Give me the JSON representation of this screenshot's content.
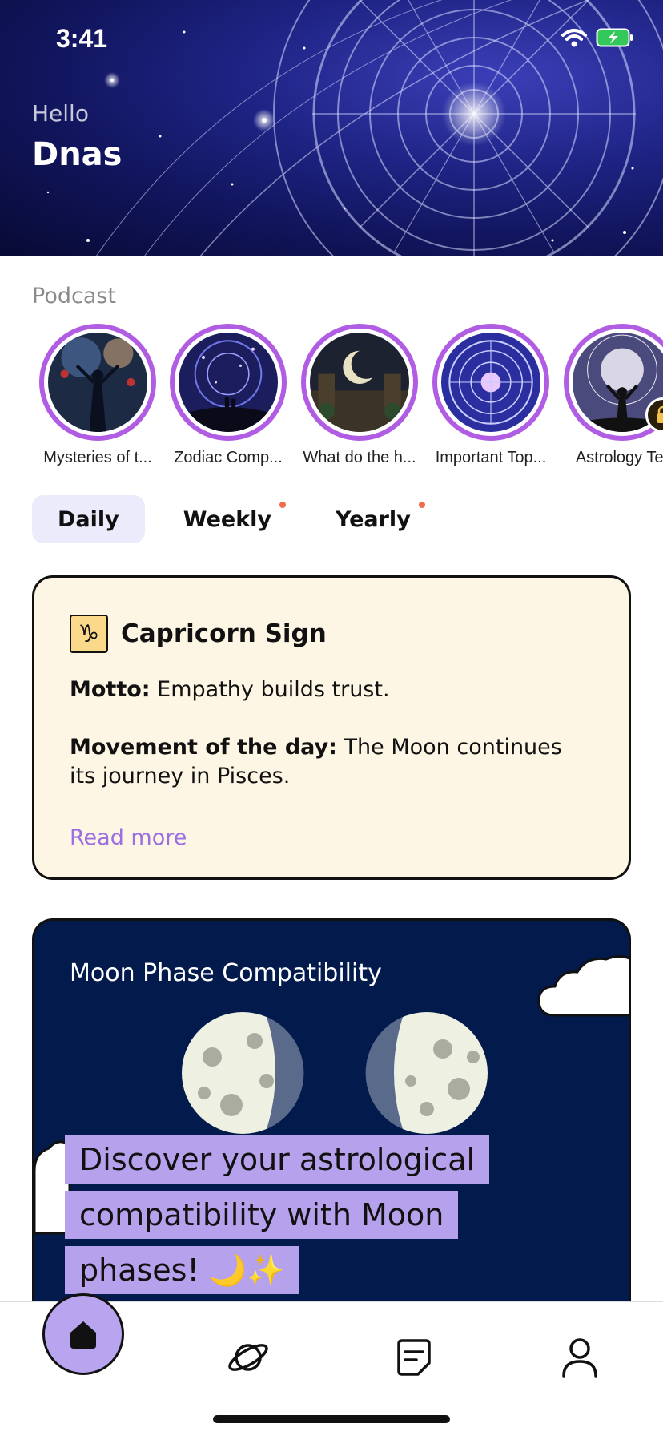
{
  "status_bar": {
    "time": "3:41"
  },
  "greeting": {
    "hello": "Hello",
    "name": "Dnas"
  },
  "podcast": {
    "title": "Podcast",
    "items": [
      {
        "label": "Mysteries of t...",
        "locked": false
      },
      {
        "label": "Zodiac Comp...",
        "locked": false
      },
      {
        "label": "What do the h...",
        "locked": false
      },
      {
        "label": "Important Top...",
        "locked": false
      },
      {
        "label": "Astrology Ter",
        "locked": true
      }
    ]
  },
  "tabs": [
    {
      "label": "Daily",
      "active": true,
      "dot": false
    },
    {
      "label": "Weekly",
      "active": false,
      "dot": true
    },
    {
      "label": "Yearly",
      "active": false,
      "dot": true
    }
  ],
  "sign_card": {
    "icon": "capricorn-icon",
    "title": "Capricorn Sign",
    "motto_label": "Motto:",
    "motto_text": " Empathy builds trust.",
    "movement_label": "Movement of the day:",
    "movement_text": " The Moon continues its journey in Pisces.",
    "read_more": "Read more"
  },
  "moon_card": {
    "title": "Moon Phase Compatibility",
    "text": "Discover your astrological compatibility with Moon phases! 🌙✨"
  },
  "bottom_nav": [
    {
      "icon": "home-icon",
      "active": true
    },
    {
      "icon": "planet-icon",
      "active": false
    },
    {
      "icon": "notes-icon",
      "active": false
    },
    {
      "icon": "profile-icon",
      "active": false
    }
  ],
  "colors": {
    "accent_purple": "#b05ce3",
    "tab_active_bg": "#ebebfb",
    "sign_card_bg": "#fef6e5",
    "moon_card_bg": "#031a4d",
    "link_purple": "#9b6fe0",
    "highlight_lavender": "#b6a2ec"
  }
}
